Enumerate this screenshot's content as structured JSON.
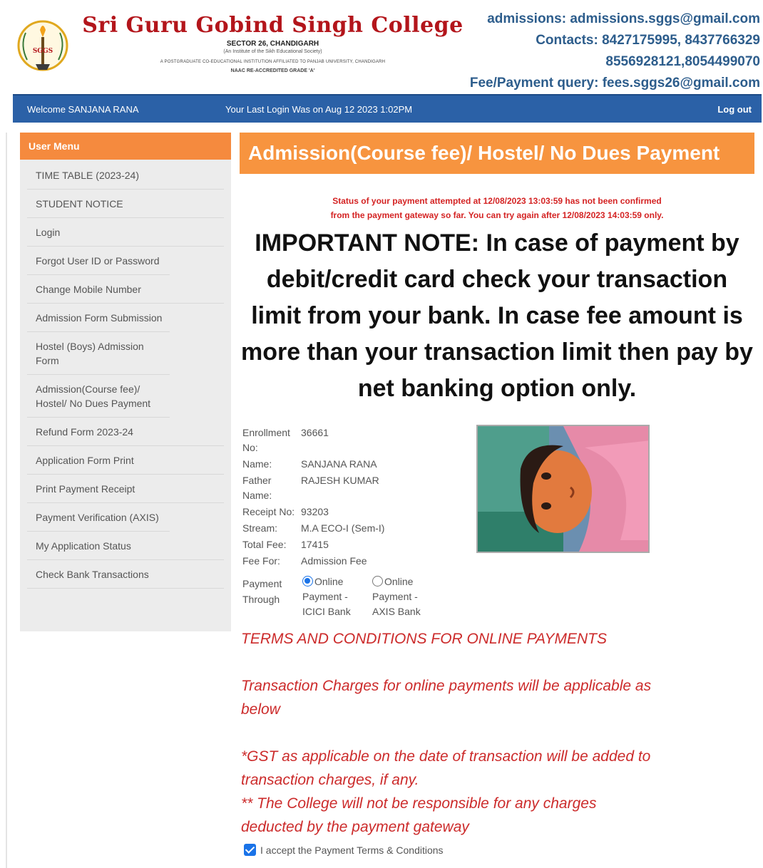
{
  "header": {
    "college_name": "Sri Guru Gobind Singh College",
    "sector": "SECTOR 26, CHANDIGARH",
    "society": "(An Institute of the Sikh Educational Society)",
    "affiliation": "A POSTGRADUATE CO-EDUCATIONAL INSTITUTION AFFILIATED TO PANJAB UNIVERSITY, CHANDIGARH",
    "naac": "NAAC RE-ACCREDITED GRADE 'A'",
    "logo_text": "SGGS",
    "contacts": {
      "admissions": "admissions: admissions.sggs@gmail.com",
      "phones_1": "Contacts: 8427175995, 8437766329",
      "phones_2": "8556928121,8054499070",
      "fee_query": "Fee/Payment query: fees.sggs26@gmail.com"
    }
  },
  "topbar": {
    "welcome": "Welcome SANJANA RANA",
    "last_login": "Your Last Login Was on Aug 12 2023 1:02PM",
    "logout": "Log out",
    "color": "#2b61a7"
  },
  "sidebar": {
    "title": "User Menu",
    "accent": "#f58a3e",
    "items": [
      "TIME TABLE (2023-24)",
      "STUDENT NOTICE",
      "Login",
      "Forgot User ID or Password",
      "Change Mobile Number",
      "Admission Form Submission",
      "Hostel (Boys) Admission Form",
      "Admission(Course fee)/ Hostel/ No Dues Payment",
      "Refund Form 2023-24",
      "Application Form Print",
      "Print Payment Receipt",
      "Payment Verification (AXIS)",
      "My Application Status",
      "Check Bank Transactions"
    ]
  },
  "main": {
    "title": "Admission(Course fee)/ Hostel/ No Dues Payment",
    "status_line1": "Status of your payment attempted at 12/08/2023 13:03:59 has not been confirmed",
    "status_line2": "from the payment gateway so far. You can try again after 12/08/2023 14:03:59 only.",
    "important_note": "IMPORTANT NOTE: In case of payment by debit/credit card check your transaction limit from your bank. In case fee amount is more than your transaction limit then pay by net banking option only.",
    "student": {
      "enrollment_label": "Enrollment No:",
      "enrollment": "36661",
      "name_label": "Name:",
      "name": "SANJANA RANA",
      "father_label": "Father Name:",
      "father": "RAJESH KUMAR",
      "receipt_label": "Receipt No:",
      "receipt": "93203",
      "stream_label": "Stream:",
      "stream": "M.A ECO-I (Sem-I)",
      "total_fee_label": "Total Fee:",
      "total_fee": "17415",
      "fee_for_label": "Fee For:",
      "fee_for": "Admission Fee"
    },
    "payment": {
      "label": "Payment Through",
      "option_icici": "Online Payment - ICICI Bank",
      "option_axis": "Online Payment - AXIS Bank",
      "selected": "icici"
    },
    "terms": {
      "heading": "TERMS AND CONDITIONS FOR ONLINE PAYMENTS",
      "charges": "Transaction Charges for online payments will be applicable as below",
      "gst": "*GST as applicable on the date of transaction will be added to transaction charges, if any.",
      "disclaimer": "** The College will not be responsible for any charges deducted by the payment gateway",
      "color": "#cc2b2b"
    },
    "accept_label": "I accept the Payment Terms & Conditions"
  }
}
